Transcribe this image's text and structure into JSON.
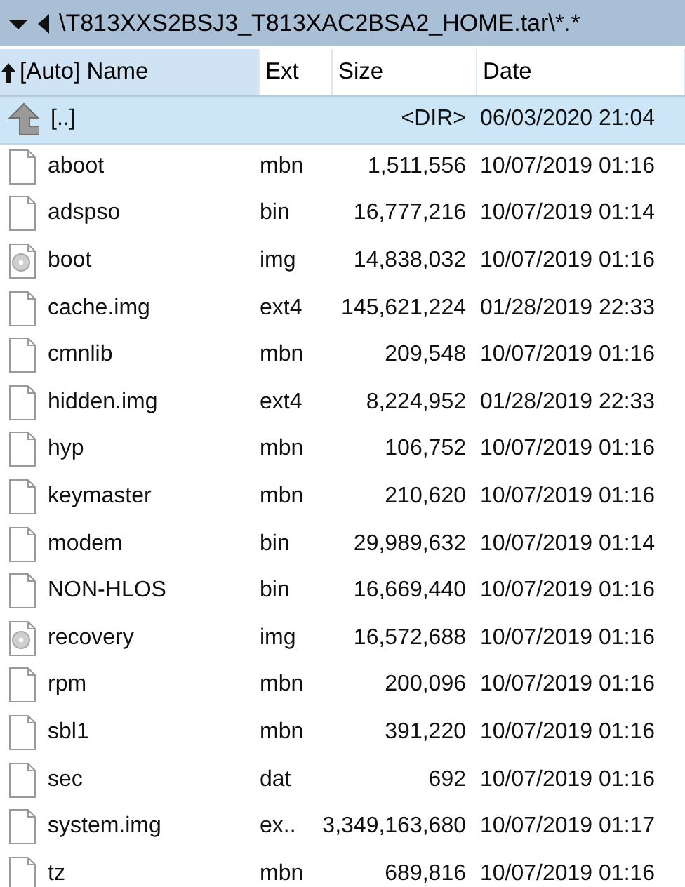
{
  "path_bar": {
    "path": "\\T813XXS2BSJ3_T813XAC2BSA2_HOME.tar\\*.*"
  },
  "columns": [
    {
      "label": "[Auto] Name",
      "sorted": true
    },
    {
      "label": "Ext",
      "sorted": false
    },
    {
      "label": "Size",
      "sorted": false
    },
    {
      "label": "Date",
      "sorted": false
    }
  ],
  "rows": [
    {
      "kind": "parent",
      "name": "[..]",
      "ext": "",
      "size": "<DIR>",
      "date": "06/03/2020 21:04",
      "selected": true
    },
    {
      "kind": "file",
      "name": "aboot",
      "ext": "mbn",
      "size": "1,511,556",
      "date": "10/07/2019 01:16",
      "selected": false
    },
    {
      "kind": "file",
      "name": "adspso",
      "ext": "bin",
      "size": "16,777,216",
      "date": "10/07/2019 01:14",
      "selected": false
    },
    {
      "kind": "disc",
      "name": "boot",
      "ext": "img",
      "size": "14,838,032",
      "date": "10/07/2019 01:16",
      "selected": false
    },
    {
      "kind": "file",
      "name": "cache.img",
      "ext": "ext4",
      "size": "145,621,224",
      "date": "01/28/2019 22:33",
      "selected": false
    },
    {
      "kind": "file",
      "name": "cmnlib",
      "ext": "mbn",
      "size": "209,548",
      "date": "10/07/2019 01:16",
      "selected": false
    },
    {
      "kind": "file",
      "name": "hidden.img",
      "ext": "ext4",
      "size": "8,224,952",
      "date": "01/28/2019 22:33",
      "selected": false
    },
    {
      "kind": "file",
      "name": "hyp",
      "ext": "mbn",
      "size": "106,752",
      "date": "10/07/2019 01:16",
      "selected": false
    },
    {
      "kind": "file",
      "name": "keymaster",
      "ext": "mbn",
      "size": "210,620",
      "date": "10/07/2019 01:16",
      "selected": false
    },
    {
      "kind": "file",
      "name": "modem",
      "ext": "bin",
      "size": "29,989,632",
      "date": "10/07/2019 01:14",
      "selected": false
    },
    {
      "kind": "file",
      "name": "NON-HLOS",
      "ext": "bin",
      "size": "16,669,440",
      "date": "10/07/2019 01:16",
      "selected": false
    },
    {
      "kind": "disc",
      "name": "recovery",
      "ext": "img",
      "size": "16,572,688",
      "date": "10/07/2019 01:16",
      "selected": false
    },
    {
      "kind": "file",
      "name": "rpm",
      "ext": "mbn",
      "size": "200,096",
      "date": "10/07/2019 01:16",
      "selected": false
    },
    {
      "kind": "file",
      "name": "sbl1",
      "ext": "mbn",
      "size": "391,220",
      "date": "10/07/2019 01:16",
      "selected": false
    },
    {
      "kind": "file",
      "name": "sec",
      "ext": "dat",
      "size": "692",
      "date": "10/07/2019 01:16",
      "selected": false
    },
    {
      "kind": "file",
      "name": "system.img",
      "ext": "ex..",
      "size": "3,349,163,680",
      "date": "10/07/2019 01:17",
      "selected": false
    },
    {
      "kind": "file",
      "name": "tz",
      "ext": "mbn",
      "size": "689,816",
      "date": "10/07/2019 01:16",
      "selected": false
    }
  ]
}
